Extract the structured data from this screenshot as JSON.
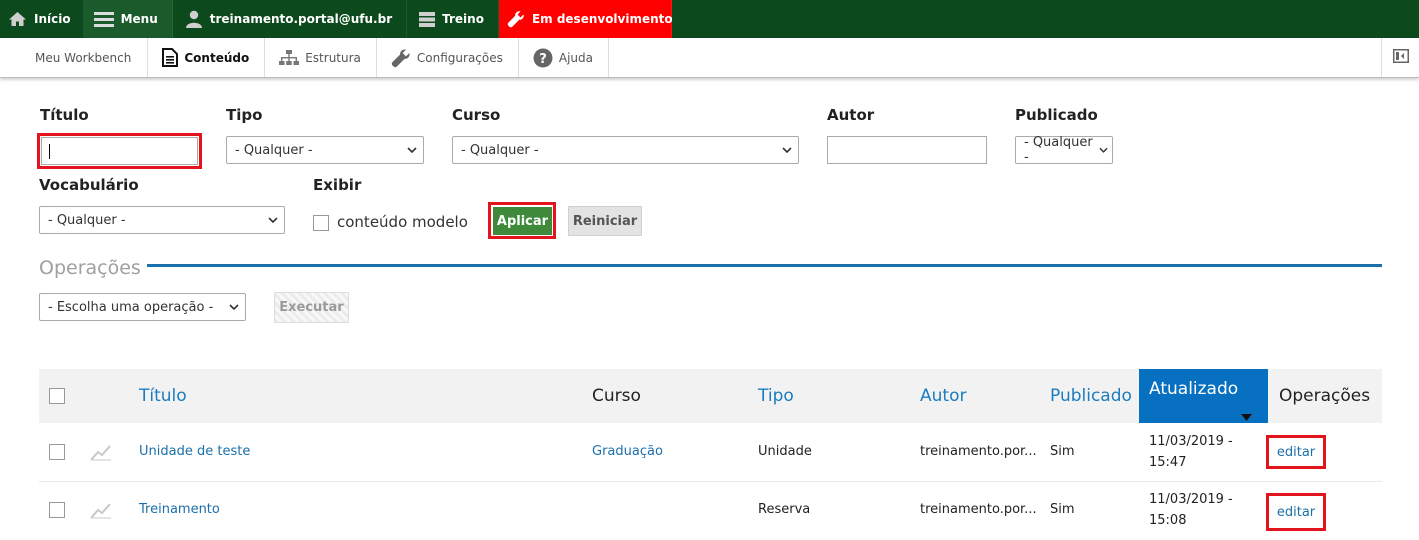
{
  "toolbar": {
    "home_label": "Início",
    "menu_label": "Menu",
    "user_label": "treinamento.portal@ufu.br",
    "shortcuts_label": "Treino",
    "env_label": "Em desenvolvimento",
    "env_color": "#ff0000",
    "bar_color": "#0c4a1e"
  },
  "tray": {
    "items": [
      {
        "label": "Meu Workbench",
        "icon": null
      },
      {
        "label": "Conteúdo",
        "icon": "document-icon",
        "active": true
      },
      {
        "label": "Estrutura",
        "icon": "sitemap-icon"
      },
      {
        "label": "Configurações",
        "icon": "wrench-icon"
      },
      {
        "label": "Ajuda",
        "icon": "help-icon"
      }
    ],
    "toggle_icon": "sidebar-toggle-icon"
  },
  "filters": {
    "title_label": "Título",
    "title_value": "",
    "type_label": "Tipo",
    "type_selected": "- Qualquer -",
    "course_label": "Curso",
    "course_selected": "- Qualquer -",
    "author_label": "Autor",
    "author_value": "",
    "published_label": "Publicado",
    "published_selected": "- Qualquer -",
    "vocabulary_label": "Vocabulário",
    "vocabulary_selected": "- Qualquer -",
    "display_label": "Exibir",
    "template_checkbox_label": "conteúdo modelo",
    "apply_label": "Aplicar",
    "reset_label": "Reiniciar"
  },
  "operations": {
    "legend": "Operações",
    "select_placeholder": "- Escolha uma operação -",
    "execute_label": "Executar"
  },
  "table": {
    "headers": {
      "title": "Título",
      "course": "Curso",
      "type": "Tipo",
      "author": "Autor",
      "published": "Publicado",
      "updated": "Atualizado",
      "operations": "Operações"
    },
    "rows": [
      {
        "title": "Unidade de teste",
        "course": "Graduação",
        "type": "Unidade",
        "author": "treinamento.por...",
        "published": "Sim",
        "updated_date": "11/03/2019 -",
        "updated_time": "15:47",
        "operation": "editar"
      },
      {
        "title": "Treinamento",
        "course": "",
        "type": "Reserva",
        "author": "treinamento.por...",
        "published": "Sim",
        "updated_date": "11/03/2019 -",
        "updated_time": "15:08",
        "operation": "editar"
      }
    ]
  },
  "colors": {
    "highlight": "#e3141e",
    "link": "#1b6faa",
    "active_header": "#0870c1",
    "apply_button": "#3e8a3a"
  }
}
